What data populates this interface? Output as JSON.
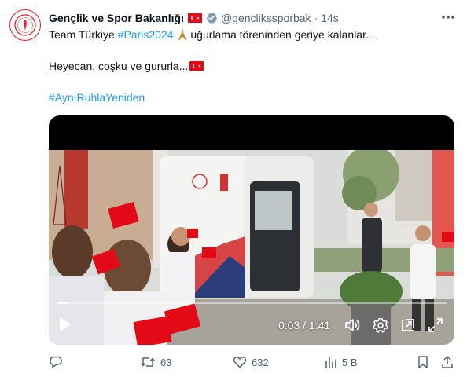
{
  "colors": {
    "accent": "#1d9bf0",
    "text": "#0f1419",
    "muted": "#536471",
    "flag_red": "#e30a17"
  },
  "author": {
    "name": "Gençlik ve Spor Bakanlığı",
    "handle": "@genclikssporbak",
    "time": "14s",
    "verified_icon": "verified-badge-icon",
    "flag_icon": "turkey-flag-icon"
  },
  "tweet": {
    "line1_prefix": "Team Türkiye ",
    "line1_hashtag": "#Paris2024",
    "line1_suffix": " uğurlama töreninden geriye kalanlar...",
    "line2": "Heyecan, coşku ve gururla...",
    "line3_hashtag": "#AynıRuhlaYeniden"
  },
  "video": {
    "timecode": "0:03 / 1:41",
    "progress": 0.03
  },
  "actions": {
    "reply_icon": "reply-icon",
    "retweet_count": "63",
    "like_count": "632",
    "views_count": "5 B"
  }
}
